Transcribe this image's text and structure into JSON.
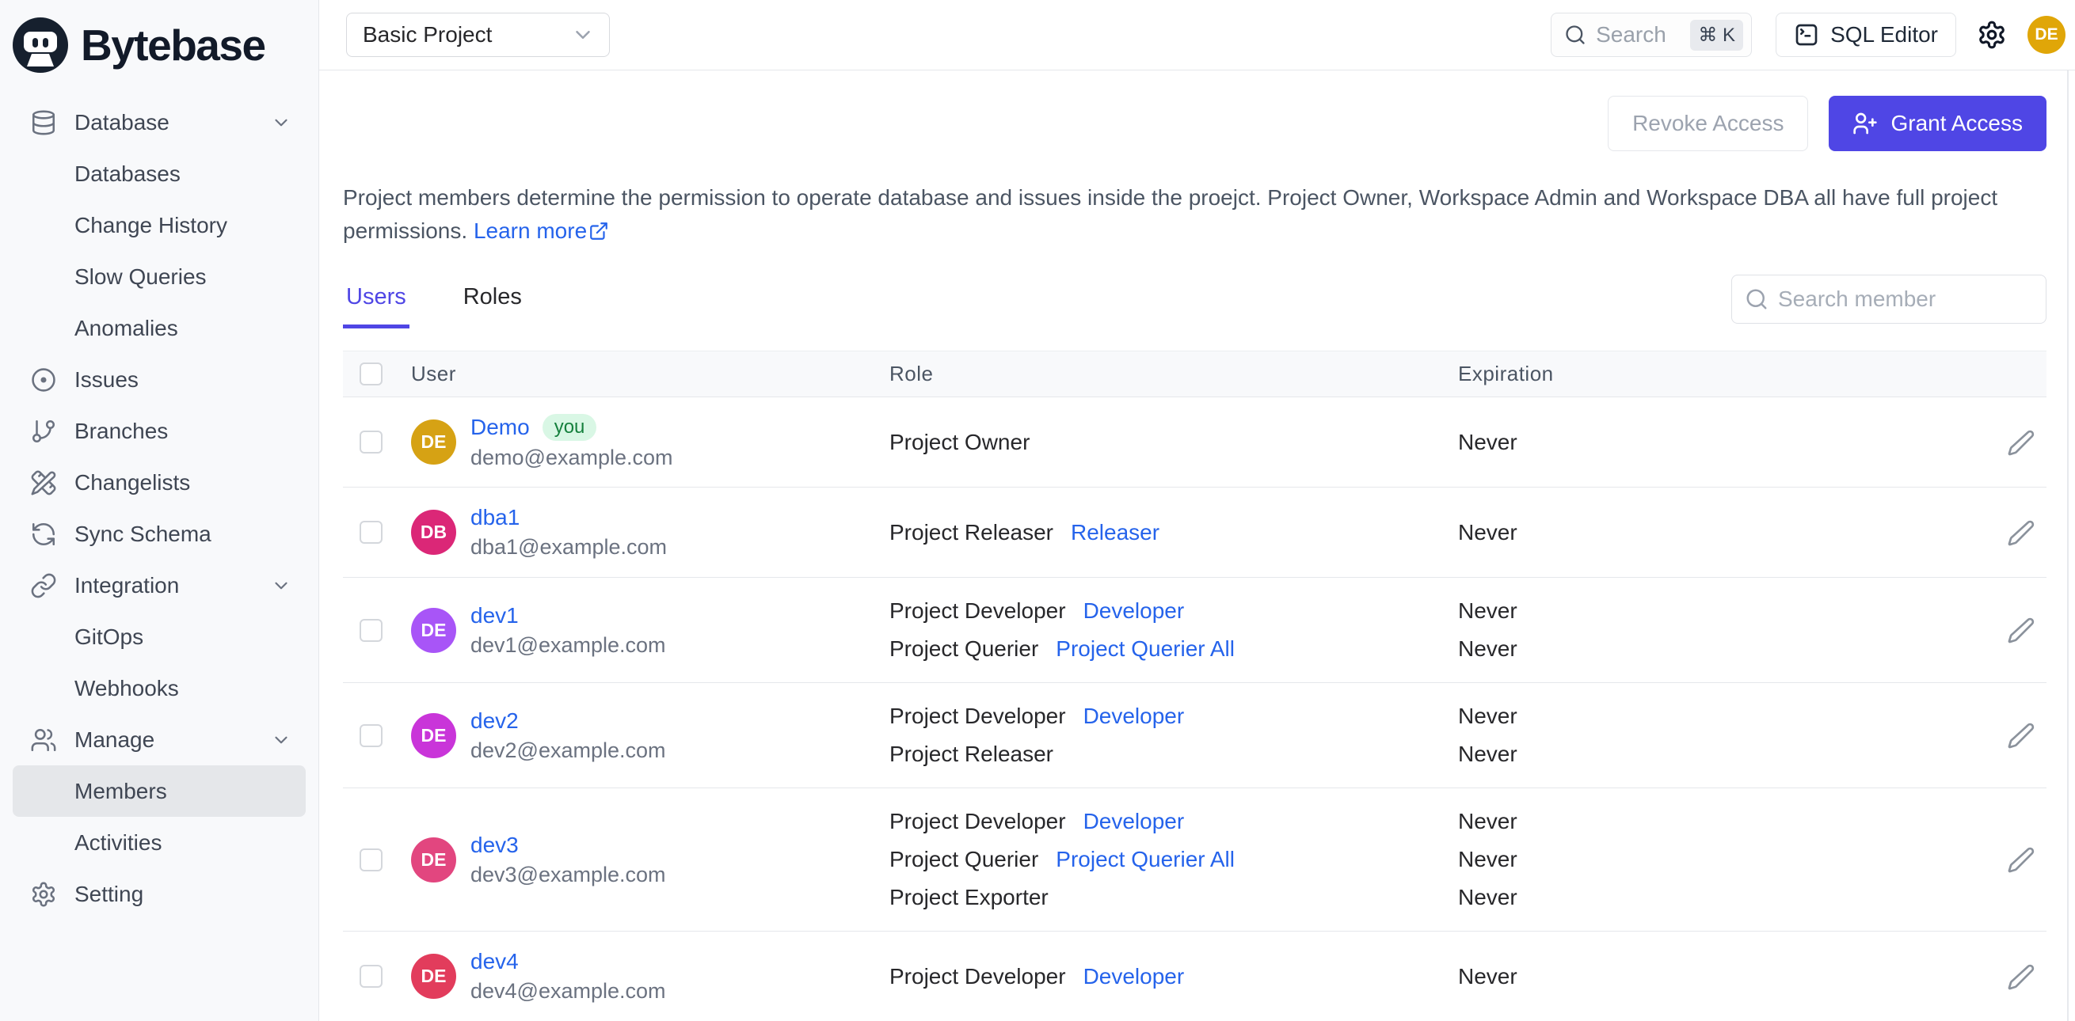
{
  "app": {
    "brand": "Bytebase"
  },
  "topbar": {
    "project": "Basic Project",
    "search_placeholder": "Search",
    "shortcut": "⌘ K",
    "sql_editor": "SQL Editor",
    "avatar_initials": "DE",
    "avatar_color": "#e0a608"
  },
  "sidebar": {
    "items": [
      {
        "label": "Database",
        "icon": "database",
        "chevron": true
      },
      {
        "label": "Databases",
        "sub": true
      },
      {
        "label": "Change History",
        "sub": true
      },
      {
        "label": "Slow Queries",
        "sub": true
      },
      {
        "label": "Anomalies",
        "sub": true
      },
      {
        "label": "Issues",
        "icon": "circle-dot"
      },
      {
        "label": "Branches",
        "icon": "git-branch"
      },
      {
        "label": "Changelists",
        "icon": "pencil-ruler"
      },
      {
        "label": "Sync Schema",
        "icon": "refresh"
      },
      {
        "label": "Integration",
        "icon": "link",
        "chevron": true
      },
      {
        "label": "GitOps",
        "sub": true
      },
      {
        "label": "Webhooks",
        "sub": true
      },
      {
        "label": "Manage",
        "icon": "users",
        "chevron": true
      },
      {
        "label": "Members",
        "sub": true,
        "selected": true
      },
      {
        "label": "Activities",
        "sub": true
      },
      {
        "label": "Setting",
        "icon": "gear"
      }
    ]
  },
  "page": {
    "revoke_button": "Revoke Access",
    "grant_button": "Grant Access",
    "description": "Project members determine the permission to operate database and issues inside the proejct. Project Owner, Workspace Admin and Workspace DBA all have full project permissions.",
    "learn_more": "Learn more",
    "tabs": [
      {
        "label": "Users",
        "active": true
      },
      {
        "label": "Roles",
        "active": false
      }
    ],
    "member_search_placeholder": "Search member",
    "table": {
      "headers": [
        "User",
        "Role",
        "Expiration"
      ],
      "rows": [
        {
          "initials": "DE",
          "avatar_color": "#d6a214",
          "name": "Demo",
          "you_badge": "you",
          "email": "demo@example.com",
          "bindings": [
            {
              "role": "Project Owner",
              "link": "",
              "expiration": "Never"
            }
          ]
        },
        {
          "initials": "DB",
          "avatar_color": "#db2777",
          "name": "dba1",
          "email": "dba1@example.com",
          "bindings": [
            {
              "role": "Project Releaser",
              "link": "Releaser",
              "expiration": "Never"
            }
          ]
        },
        {
          "initials": "DE",
          "avatar_color": "#a855f7",
          "name": "dev1",
          "email": "dev1@example.com",
          "bindings": [
            {
              "role": "Project Developer",
              "link": "Developer",
              "expiration": "Never"
            },
            {
              "role": "Project Querier",
              "link": "Project Querier All",
              "expiration": "Never"
            }
          ]
        },
        {
          "initials": "DE",
          "avatar_color": "#c935d9",
          "name": "dev2",
          "email": "dev2@example.com",
          "bindings": [
            {
              "role": "Project Developer",
              "link": "Developer",
              "expiration": "Never"
            },
            {
              "role": "Project Releaser",
              "link": "",
              "expiration": "Never"
            }
          ]
        },
        {
          "initials": "DE",
          "avatar_color": "#e2467f",
          "name": "dev3",
          "email": "dev3@example.com",
          "bindings": [
            {
              "role": "Project Developer",
              "link": "Developer",
              "expiration": "Never"
            },
            {
              "role": "Project Querier",
              "link": "Project Querier All",
              "expiration": "Never"
            },
            {
              "role": "Project Exporter",
              "link": "",
              "expiration": "Never"
            }
          ]
        },
        {
          "initials": "DE",
          "avatar_color": "#e23c5c",
          "name": "dev4",
          "email": "dev4@example.com",
          "bindings": [
            {
              "role": "Project Developer",
              "link": "Developer",
              "expiration": "Never"
            }
          ]
        }
      ]
    }
  },
  "colors": {
    "accent": "#4f46e5",
    "link": "#2563eb"
  }
}
